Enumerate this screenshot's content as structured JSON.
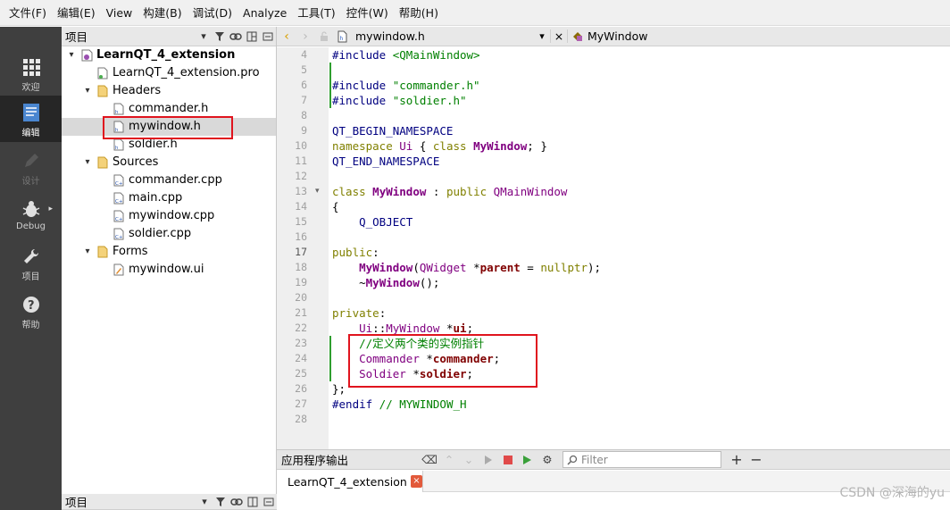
{
  "menu": [
    "文件(F)",
    "编辑(E)",
    "View",
    "构建(B)",
    "调试(D)",
    "Analyze",
    "工具(T)",
    "控件(W)",
    "帮助(H)"
  ],
  "modes": [
    {
      "label": "欢迎",
      "icon": "grid-icon"
    },
    {
      "label": "编辑",
      "icon": "edit-icon"
    },
    {
      "label": "设计",
      "icon": "pencil-icon"
    },
    {
      "label": "Debug",
      "icon": "bug-icon"
    },
    {
      "label": "项目",
      "icon": "wrench-icon"
    },
    {
      "label": "帮助",
      "icon": "help-icon"
    }
  ],
  "project_panel": {
    "title": "项目",
    "bottom_title": "项目",
    "tree": [
      {
        "label": "LearnQT_4_extension",
        "level": 0,
        "kind": "project",
        "expanded": true
      },
      {
        "label": "LearnQT_4_extension.pro",
        "level": 1,
        "kind": "pro"
      },
      {
        "label": "Headers",
        "level": 1,
        "kind": "folder",
        "expanded": true
      },
      {
        "label": "commander.h",
        "level": 2,
        "kind": "h"
      },
      {
        "label": "mywindow.h",
        "level": 2,
        "kind": "h",
        "selected": true
      },
      {
        "label": "soldier.h",
        "level": 2,
        "kind": "h"
      },
      {
        "label": "Sources",
        "level": 1,
        "kind": "folder",
        "expanded": true
      },
      {
        "label": "commander.cpp",
        "level": 2,
        "kind": "cpp"
      },
      {
        "label": "main.cpp",
        "level": 2,
        "kind": "cpp"
      },
      {
        "label": "mywindow.cpp",
        "level": 2,
        "kind": "cpp"
      },
      {
        "label": "soldier.cpp",
        "level": 2,
        "kind": "cpp"
      },
      {
        "label": "Forms",
        "level": 1,
        "kind": "folder",
        "expanded": true
      },
      {
        "label": "mywindow.ui",
        "level": 2,
        "kind": "ui"
      }
    ]
  },
  "editor": {
    "file": "mywindow.h",
    "symbol": "MyWindow",
    "current_line": "17",
    "lines": [
      {
        "n": "4",
        "code": "#include <QMainWindow>",
        "changed": false
      },
      {
        "n": "5",
        "code": "",
        "changed": true
      },
      {
        "n": "6",
        "code": "#include \"commander.h\"",
        "changed": true
      },
      {
        "n": "7",
        "code": "#include \"soldier.h\"",
        "changed": true
      },
      {
        "n": "8",
        "code": "",
        "changed": false
      },
      {
        "n": "9",
        "code": "QT_BEGIN_NAMESPACE",
        "changed": false
      },
      {
        "n": "10",
        "code": "namespace Ui { class MyWindow; }",
        "changed": false
      },
      {
        "n": "11",
        "code": "QT_END_NAMESPACE",
        "changed": false
      },
      {
        "n": "12",
        "code": "",
        "changed": false
      },
      {
        "n": "13",
        "code": "class MyWindow : public QMainWindow",
        "changed": false
      },
      {
        "n": "14",
        "code": "{",
        "changed": false
      },
      {
        "n": "15",
        "code": "    Q_OBJECT",
        "changed": false
      },
      {
        "n": "16",
        "code": "",
        "changed": false
      },
      {
        "n": "17",
        "code": "public:",
        "changed": false
      },
      {
        "n": "18",
        "code": "    MyWindow(QWidget *parent = nullptr);",
        "changed": false
      },
      {
        "n": "19",
        "code": "    ~MyWindow();",
        "changed": false
      },
      {
        "n": "20",
        "code": "",
        "changed": false
      },
      {
        "n": "21",
        "code": "private:",
        "changed": false
      },
      {
        "n": "22",
        "code": "    Ui::MyWindow *ui;",
        "changed": false
      },
      {
        "n": "23",
        "code": "    //定义两个类的实例指针",
        "changed": true
      },
      {
        "n": "24",
        "code": "    Commander *commander;",
        "changed": true
      },
      {
        "n": "25",
        "code": "    Soldier *soldier;",
        "changed": true
      },
      {
        "n": "26",
        "code": "};",
        "changed": false
      },
      {
        "n": "27",
        "code": "#endif // MYWINDOW_H",
        "changed": false
      },
      {
        "n": "28",
        "code": "",
        "changed": false
      }
    ]
  },
  "output": {
    "title": "应用程序输出",
    "filter_placeholder": "Filter",
    "tab_label": "LearnQT_4_extension",
    "close_glyph": "×"
  },
  "watermark": "CSDN @深海的yu",
  "colors": {
    "highlight_box": "#e0141e",
    "change_marker": "#2f9e2f",
    "mode_bar": "#3f3f3f"
  }
}
